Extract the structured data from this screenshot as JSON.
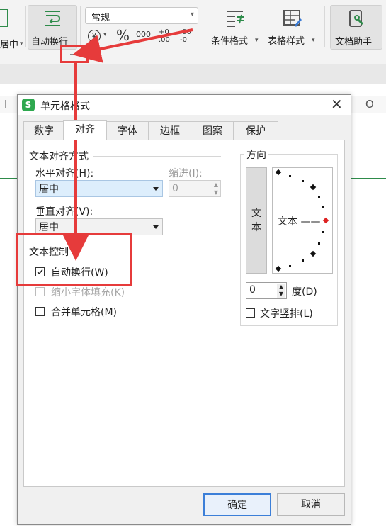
{
  "ribbon": {
    "merge_center_label": "居中",
    "wrap_text_label": "自动换行",
    "number_format": "常规",
    "conditional_format_label": "条件格式",
    "table_style_label": "表格样式",
    "doc_assistant_label": "文档助手",
    "percent_symbol": "%",
    "thousands_symbol": "000",
    "increase_decimal": "+0 .00",
    "decrease_decimal": ".00 -0"
  },
  "columns": {
    "left": "I",
    "right": "O"
  },
  "dialog": {
    "title": "单元格格式",
    "tabs": [
      "数字",
      "对齐",
      "字体",
      "边框",
      "图案",
      "保护"
    ],
    "text_alignment": {
      "section_title": "文本对齐方式",
      "horizontal_label": "水平对齐(H):",
      "horizontal_value": "居中",
      "indent_label": "缩进(I):",
      "indent_value": "0",
      "vertical_label": "垂直对齐(V):",
      "vertical_value": "居中"
    },
    "text_control": {
      "section_title": "文本控制",
      "wrap_text_label": "自动换行(W)",
      "wrap_text_checked": true,
      "shrink_to_fit_label": "缩小字体填充(K)",
      "merge_cells_label": "合并单元格(M)"
    },
    "orientation": {
      "section_title": "方向",
      "vertical_text": "文本",
      "horizontal_text": "文本 ——",
      "degree_value": "0",
      "degree_label": "度(D)",
      "vertical_text_label": "文字竖排(L)"
    },
    "ok_label": "确定",
    "cancel_label": "取消"
  },
  "colors": {
    "accent": "#2e8b4a",
    "highlight": "#e63b3b",
    "selection": "#ddeefc"
  }
}
